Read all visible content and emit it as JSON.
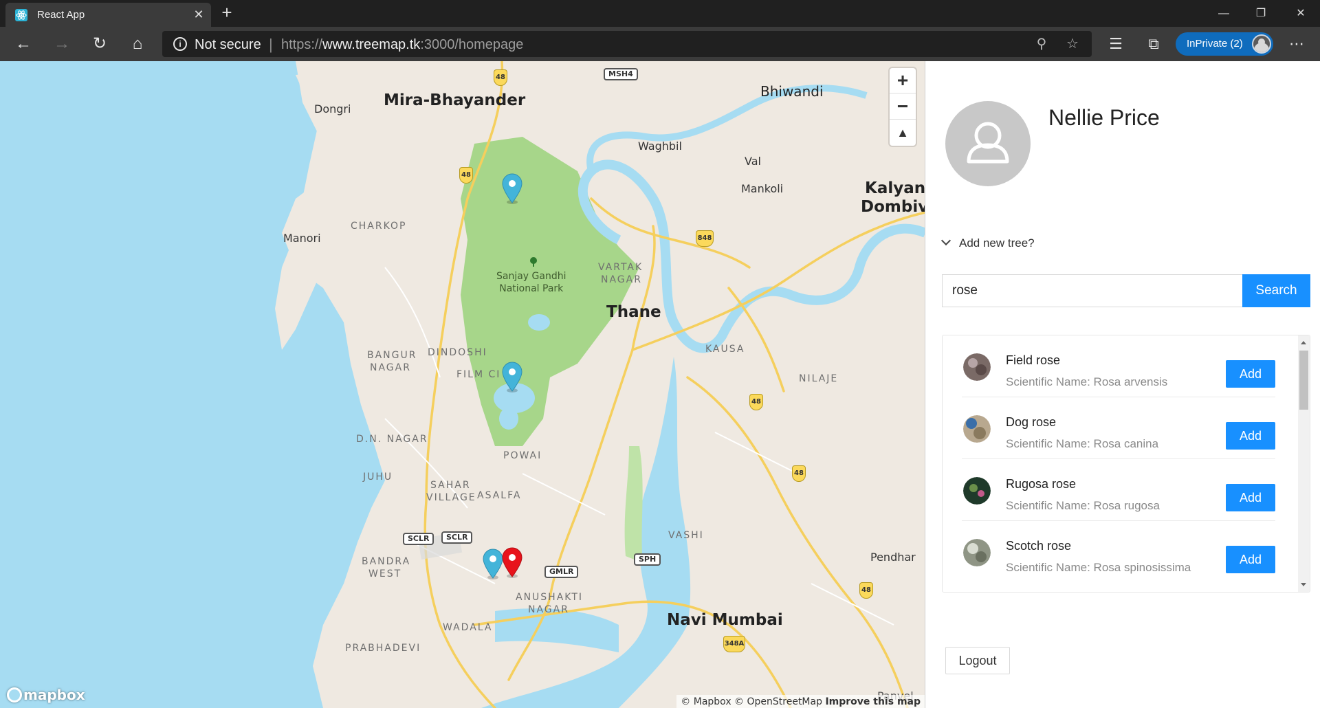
{
  "browser": {
    "tab_title": "React App",
    "tab_icon": "react-icon",
    "security_label": "Not secure",
    "url_prefix": "https://",
    "url_host": "www.treemap.tk",
    "url_rest": ":3000/homepage",
    "inprivate_label": "InPrivate (2)"
  },
  "map": {
    "places": {
      "mira": "Mira-Bhayander",
      "dongri": "Dongri",
      "bhiwandi": "Bhiwandi",
      "waghbil": "Waghbil",
      "val": "Val",
      "mankoli": "Mankoli",
      "kalyan1": "Kalyan-",
      "kalyan2": "Dombivl",
      "manori": "Manori",
      "charkop": "CHARKOP",
      "sgnp1": "Sanjay Gandhi",
      "sgnp2": "National Park",
      "vartak1": "VARTAK",
      "vartak2": "NAGAR",
      "thane": "Thane",
      "bangur1": "BANGUR",
      "bangur2": "NAGAR",
      "dindoshi": "DINDOSHI",
      "filmcity": "FILM CI",
      "kausa": "KAUSA",
      "nilaje": "NILAJE",
      "dnnagar": "D.N. NAGAR",
      "powai": "POWAI",
      "juhu": "JUHU",
      "sahar1": "SAHAR",
      "sahar2": "VILLAGE",
      "asalfa": "ASALFA",
      "bandra1": "BANDRA",
      "bandra2": "WEST",
      "anushakti1": "ANUSHAKTI",
      "anushakti2": "NAGAR",
      "vashi": "VASHI",
      "pendhar": "Pendhar",
      "wadala": "WADALA",
      "prabhadevi": "PRABHADEVI",
      "navimumbai": "Navi Mumbai",
      "panvel": "Panvel"
    },
    "shields": {
      "s48a": "48",
      "s48b": "48",
      "s48c": "48",
      "s48d": "48",
      "s48e": "48",
      "s848": "848",
      "s348a": "348A"
    },
    "roadboxes": {
      "msh4": "MSH4",
      "sclr1": "SCLR",
      "sclr2": "SCLR",
      "gmlr": "GMLR",
      "sph": "SPH"
    },
    "zoom_in": "+",
    "zoom_out": "−",
    "compass": "▲",
    "logo": "mapbox",
    "attribution": "© Mapbox © OpenStreetMap",
    "improve": "Improve this map",
    "colors": {
      "water": "#a6dcf2",
      "land": "#efe9e1",
      "park": "#a7d68a",
      "road": "#f5cf5d",
      "pin_blue": "#43b4d9",
      "pin_red": "#e8131b"
    }
  },
  "panel": {
    "user_name": "Nellie Price",
    "add_tree_label": "Add new tree?",
    "search_value": "rose",
    "search_button": "Search",
    "results": [
      {
        "name": "Field rose",
        "scientific": "Scientific Name: Rosa arvensis",
        "add": "Add"
      },
      {
        "name": "Dog rose",
        "scientific": "Scientific Name: Rosa canina",
        "add": "Add"
      },
      {
        "name": "Rugosa rose",
        "scientific": "Scientific Name: Rosa rugosa",
        "add": "Add"
      },
      {
        "name": "Scotch rose",
        "scientific": "Scientific Name: Rosa spinosissima",
        "add": "Add"
      }
    ],
    "logout": "Logout",
    "accent": "#1890ff"
  }
}
